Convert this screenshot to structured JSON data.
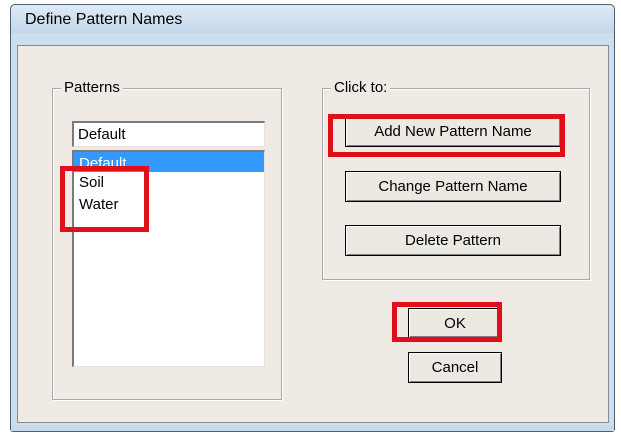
{
  "window": {
    "title": "Define Pattern Names"
  },
  "patterns_group": {
    "label": "Patterns",
    "input_value": "Default",
    "items": [
      {
        "label": "Default",
        "selected": true
      },
      {
        "label": "Soil",
        "selected": false
      },
      {
        "label": "Water",
        "selected": false
      }
    ]
  },
  "actions_group": {
    "label": "Click to:",
    "add_label": "Add New Pattern Name",
    "change_label": "Change Pattern Name",
    "delete_label": "Delete Pattern"
  },
  "footer": {
    "ok_label": "OK",
    "cancel_label": "Cancel"
  },
  "colors": {
    "highlight_box": "#e0101a",
    "selection": "#3399ff",
    "dialog_face": "#efebe4"
  }
}
